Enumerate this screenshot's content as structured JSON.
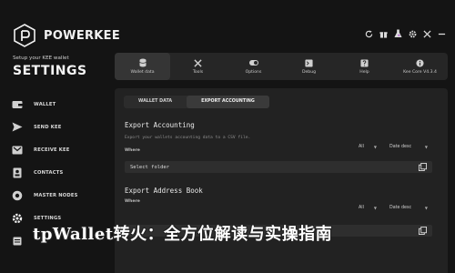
{
  "brand": {
    "name": "POWERKEE"
  },
  "sidebar": {
    "setup_text": "Setup your KEE wallet",
    "title": "SETTINGS",
    "items": [
      {
        "label": "WALLET",
        "icon": "wallet-icon"
      },
      {
        "label": "SEND KEE",
        "icon": "send-icon"
      },
      {
        "label": "RECEIVE KEE",
        "icon": "receive-icon"
      },
      {
        "label": "CONTACTS",
        "icon": "contacts-icon"
      },
      {
        "label": "MASTER NODES",
        "icon": "masternodes-icon"
      },
      {
        "label": "SETTINGS",
        "icon": "settings-icon"
      },
      {
        "label": "",
        "icon": "more-icon"
      }
    ]
  },
  "window_controls": [
    "refresh-icon",
    "gift-icon",
    "flask-icon",
    "gear-icon",
    "close-icon",
    "minimize-icon"
  ],
  "topbar": {
    "tabs": [
      {
        "label": "Wallet data",
        "icon": "database-icon",
        "active": true
      },
      {
        "label": "Tools",
        "icon": "tools-icon",
        "active": false
      },
      {
        "label": "Options",
        "icon": "options-icon",
        "active": false
      },
      {
        "label": "Debug",
        "icon": "debug-icon",
        "active": false
      },
      {
        "label": "Help",
        "icon": "help-icon",
        "active": false
      },
      {
        "label": "Kee Core V4.3.4",
        "icon": "info-icon",
        "active": false
      }
    ]
  },
  "subtabs": [
    {
      "label": "WALLET DATA",
      "active": false
    },
    {
      "label": "EXPORT ACCOUNTING",
      "active": true
    }
  ],
  "export_accounting": {
    "title": "Export Accounting",
    "description": "Export your wallets accounting data to a CSV file.",
    "where_label": "Where",
    "filter_all": "All",
    "filter_date": "Date desc",
    "folder_value": "Select folder"
  },
  "export_address_book": {
    "title": "Export Address Book",
    "where_label": "Where",
    "filter_all": "All",
    "filter_date": "Date desc"
  },
  "overlay": {
    "title": "tpWallet转火：全方位解读与实操指南"
  },
  "colors": {
    "background": "#141414",
    "panel": "#222222",
    "topbar": "#262626",
    "active_tab": "#353535"
  }
}
